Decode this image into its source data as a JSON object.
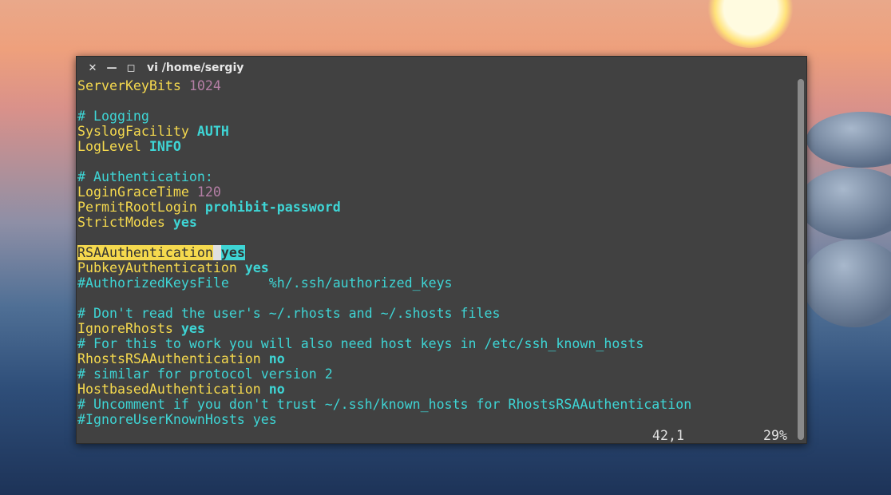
{
  "window": {
    "title": "vi /home/sergiy",
    "close_icon": "close-icon",
    "minimize_icon": "minimize-icon",
    "maximize_icon": "maximize-icon"
  },
  "colors": {
    "keyword": "#f5d94e",
    "number": "#b57fa6",
    "comment": "#3ed5d5"
  },
  "lines": [
    [
      [
        "k",
        "ServerKeyBits "
      ],
      [
        "n",
        "1024"
      ]
    ],
    [],
    [
      [
        "c",
        "# Logging"
      ]
    ],
    [
      [
        "k",
        "SyslogFacility "
      ],
      [
        "v",
        "AUTH"
      ]
    ],
    [
      [
        "k",
        "LogLevel "
      ],
      [
        "v",
        "INFO"
      ]
    ],
    [],
    [
      [
        "c",
        "# Authentication:"
      ]
    ],
    [
      [
        "k",
        "LoginGraceTime "
      ],
      [
        "n",
        "120"
      ]
    ],
    [
      [
        "k",
        "PermitRootLogin "
      ],
      [
        "v",
        "prohibit-password"
      ]
    ],
    [
      [
        "k",
        "StrictModes "
      ],
      [
        "v",
        "yes"
      ]
    ],
    [],
    [
      [
        "hl",
        "RSAAuthentication"
      ],
      [
        "cur",
        " "
      ],
      [
        "hv",
        "yes"
      ]
    ],
    [
      [
        "k",
        "PubkeyAuthentication "
      ],
      [
        "v",
        "yes"
      ]
    ],
    [
      [
        "c",
        "#AuthorizedKeysFile     %h/.ssh/authorized_keys"
      ]
    ],
    [],
    [
      [
        "c",
        "# Don't read the user's ~/.rhosts and ~/.shosts files"
      ]
    ],
    [
      [
        "k",
        "IgnoreRhosts "
      ],
      [
        "v",
        "yes"
      ]
    ],
    [
      [
        "c",
        "# For this to work you will also need host keys in /etc/ssh_known_hosts"
      ]
    ],
    [
      [
        "k",
        "RhostsRSAAuthentication "
      ],
      [
        "v",
        "no"
      ]
    ],
    [
      [
        "c",
        "# similar for protocol version 2"
      ]
    ],
    [
      [
        "k",
        "HostbasedAuthentication "
      ],
      [
        "v",
        "no"
      ]
    ],
    [
      [
        "c",
        "# Uncomment if you don't trust ~/.ssh/known_hosts for RhostsRSAAuthentication"
      ]
    ],
    [
      [
        "c",
        "#IgnoreUserKnownHosts yes"
      ]
    ]
  ],
  "status": {
    "position": "42,1",
    "percent": "29%"
  }
}
